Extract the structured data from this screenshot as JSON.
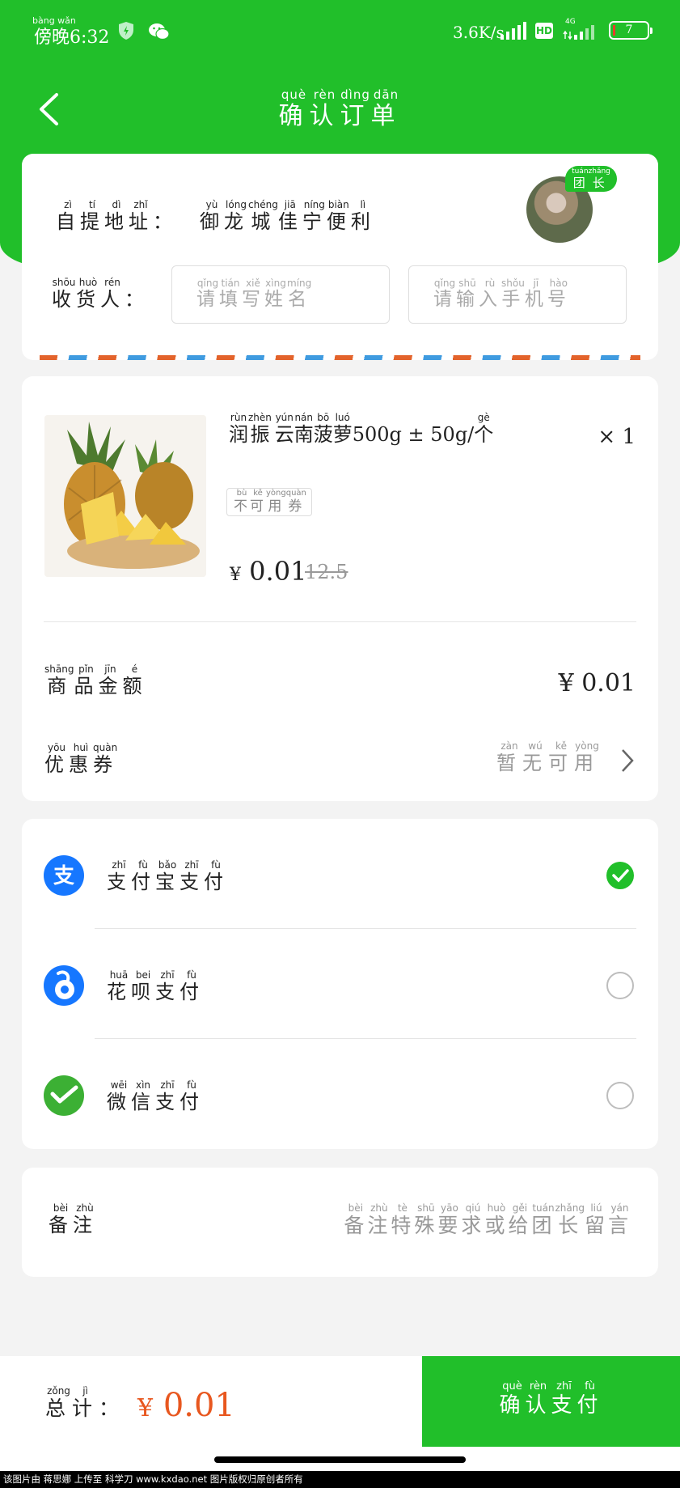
{
  "status_bar": {
    "time_pinyin": "bàng wǎn",
    "time_chars": "傍晚",
    "time": "6:32",
    "speed": "3.6K/s",
    "hd": "HD",
    "network": "4G",
    "battery": "7"
  },
  "header": {
    "title": [
      {
        "p": "què",
        "c": "确"
      },
      {
        "p": "rèn",
        "c": "认"
      },
      {
        "p": "dìng",
        "c": "订"
      },
      {
        "p": "dān",
        "c": "单"
      }
    ]
  },
  "pickup": {
    "label": [
      {
        "p": "zì",
        "c": "自"
      },
      {
        "p": "tí",
        "c": "提"
      },
      {
        "p": "dì",
        "c": "地"
      },
      {
        "p": "zhǐ",
        "c": "址"
      },
      {
        "p": "",
        "c": "："
      }
    ],
    "address": [
      {
        "p": "yù",
        "c": "御"
      },
      {
        "p": "lóng",
        "c": "龙"
      },
      {
        "p": "chéng",
        "c": "城"
      },
      {
        "p": "jiā",
        "c": "佳"
      },
      {
        "p": "níng",
        "c": "宁"
      },
      {
        "p": "biàn",
        "c": "便"
      },
      {
        "p": "lì",
        "c": "利"
      }
    ],
    "leader_tag": [
      {
        "p": "tuán",
        "c": "团"
      },
      {
        "p": "zhǎng",
        "c": "长"
      }
    ]
  },
  "receiver": {
    "label": [
      {
        "p": "shōu",
        "c": "收"
      },
      {
        "p": "huò",
        "c": "货"
      },
      {
        "p": "rén",
        "c": "人"
      },
      {
        "p": "",
        "c": "："
      }
    ],
    "name_placeholder": [
      {
        "p": "qǐng",
        "c": "请"
      },
      {
        "p": "tián",
        "c": "填"
      },
      {
        "p": "xiě",
        "c": "写"
      },
      {
        "p": "xìng",
        "c": "姓"
      },
      {
        "p": "míng",
        "c": "名"
      }
    ],
    "phone_placeholder": [
      {
        "p": "qǐng",
        "c": "请"
      },
      {
        "p": "shū",
        "c": "输"
      },
      {
        "p": "rù",
        "c": "入"
      },
      {
        "p": "shǒu",
        "c": "手"
      },
      {
        "p": "jī",
        "c": "机"
      },
      {
        "p": "hào",
        "c": "号"
      }
    ]
  },
  "product": {
    "name": [
      {
        "p": "rùn",
        "c": "润"
      },
      {
        "p": "zhèn",
        "c": "振"
      },
      {
        "p": "",
        "c": " "
      },
      {
        "p": "yún",
        "c": "云"
      },
      {
        "p": "nán",
        "c": "南"
      },
      {
        "p": "bō",
        "c": "菠"
      },
      {
        "p": "luó",
        "c": "萝"
      },
      {
        "p": "",
        "c": "500g ± 50g/"
      },
      {
        "p": "gè",
        "c": "个"
      }
    ],
    "quantity": "× 1",
    "coupon_tag": [
      {
        "p": "bù",
        "c": "不"
      },
      {
        "p": "kě",
        "c": "可"
      },
      {
        "p": "yòng",
        "c": "用"
      },
      {
        "p": "quàn",
        "c": "券"
      }
    ],
    "currency": "¥",
    "price": "0.01",
    "original_price": "12.5"
  },
  "amount": {
    "label": [
      {
        "p": "shāng",
        "c": "商"
      },
      {
        "p": "pǐn",
        "c": "品"
      },
      {
        "p": "jīn",
        "c": "金"
      },
      {
        "p": "é",
        "c": "额"
      }
    ],
    "value": "¥ 0.01"
  },
  "coupon": {
    "label": [
      {
        "p": "yōu",
        "c": "优"
      },
      {
        "p": "huì",
        "c": "惠"
      },
      {
        "p": "quàn",
        "c": "券"
      }
    ],
    "value": [
      {
        "p": "zàn",
        "c": "暂"
      },
      {
        "p": "wú",
        "c": "无"
      },
      {
        "p": "kě",
        "c": "可"
      },
      {
        "p": "yòng",
        "c": "用"
      }
    ]
  },
  "payment": {
    "options": [
      {
        "label": [
          {
            "p": "zhī",
            "c": "支"
          },
          {
            "p": "fù",
            "c": "付"
          },
          {
            "p": "bǎo",
            "c": "宝"
          },
          {
            "p": "zhī",
            "c": "支"
          },
          {
            "p": "fù",
            "c": "付"
          }
        ],
        "selected": true,
        "icon": "alipay-icon",
        "color": "#1677ff"
      },
      {
        "label": [
          {
            "p": "huā",
            "c": "花"
          },
          {
            "p": "bei",
            "c": "呗"
          },
          {
            "p": "zhī",
            "c": "支"
          },
          {
            "p": "fù",
            "c": "付"
          }
        ],
        "selected": false,
        "icon": "huabei-icon",
        "color": "#1677ff"
      },
      {
        "label": [
          {
            "p": "wēi",
            "c": "微"
          },
          {
            "p": "xìn",
            "c": "信"
          },
          {
            "p": "zhī",
            "c": "支"
          },
          {
            "p": "fù",
            "c": "付"
          }
        ],
        "selected": false,
        "icon": "wechat-pay-icon",
        "color": "#3cb034"
      }
    ]
  },
  "remark": {
    "label": [
      {
        "p": "bèi",
        "c": "备"
      },
      {
        "p": "zhù",
        "c": "注"
      }
    ],
    "placeholder": [
      {
        "p": "bèi",
        "c": "备"
      },
      {
        "p": "zhù",
        "c": "注"
      },
      {
        "p": "tè",
        "c": "特"
      },
      {
        "p": "shū",
        "c": "殊"
      },
      {
        "p": "yāo",
        "c": "要"
      },
      {
        "p": "qiú",
        "c": "求"
      },
      {
        "p": "huò",
        "c": "或"
      },
      {
        "p": "gěi",
        "c": "给"
      },
      {
        "p": "tuán",
        "c": "团"
      },
      {
        "p": "zhǎng",
        "c": "长"
      },
      {
        "p": "liú",
        "c": "留"
      },
      {
        "p": "yán",
        "c": "言"
      }
    ]
  },
  "footer": {
    "total_label": [
      {
        "p": "zǒng",
        "c": "总"
      },
      {
        "p": "jì",
        "c": "计"
      },
      {
        "p": "",
        "c": "："
      }
    ],
    "total_currency": "¥",
    "total_value": "0.01",
    "confirm": [
      {
        "p": "què",
        "c": "确"
      },
      {
        "p": "rèn",
        "c": "认"
      },
      {
        "p": "zhī",
        "c": "支"
      },
      {
        "p": "fù",
        "c": "付"
      }
    ]
  },
  "watermark": "该图片由 蒋思娜 上传至 科学刀 www.kxdao.net 图片版权归原创者所有",
  "colors": {
    "brand_green": "#21bf2a",
    "price_orange": "#e8571f",
    "alipay_blue": "#1677ff",
    "wechat_green": "#3cb034"
  }
}
